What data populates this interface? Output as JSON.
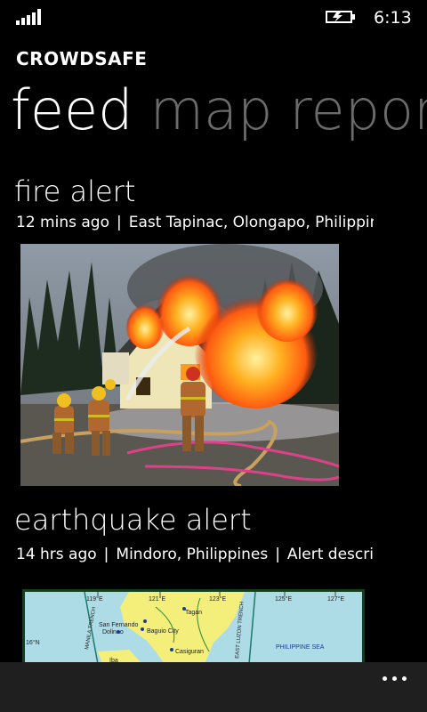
{
  "status_bar": {
    "time": "6:13"
  },
  "app": {
    "title": "CROWDSAFE"
  },
  "pivot": {
    "items": [
      "feed",
      "map",
      "report"
    ],
    "selected_index": 0
  },
  "feed": {
    "items": [
      {
        "title": "fire alert",
        "time_ago": "12 mins ago",
        "location": "East Tapinac, Olongapo, Philippines"
      },
      {
        "title": "earthquake alert",
        "time_ago": "14 hrs ago",
        "location": "Mindoro, Philippines",
        "description": "Alert description",
        "map_labels": {
          "lon1": "119°E",
          "lon2": "121°E",
          "lon3": "123°E",
          "lon4": "125°E",
          "lon5": "127°E",
          "lat1": "16°N",
          "trench_left": "MANILA TRENCH",
          "trench_right": "EAST LUZON TRENCH",
          "sea": "PHILIPPINE SEA",
          "city1": "San Fernando",
          "city2": "Baguio City",
          "city3": "Dolinao",
          "city4": "Casiguran",
          "city5": "Tagan",
          "city6": "Iba"
        }
      }
    ]
  },
  "app_bar": {
    "more_icon": "ellipsis-icon"
  },
  "colors": {
    "background": "#000000",
    "inactive_pivot": "#6b6b6b",
    "app_bar": "#1f1f1f"
  }
}
